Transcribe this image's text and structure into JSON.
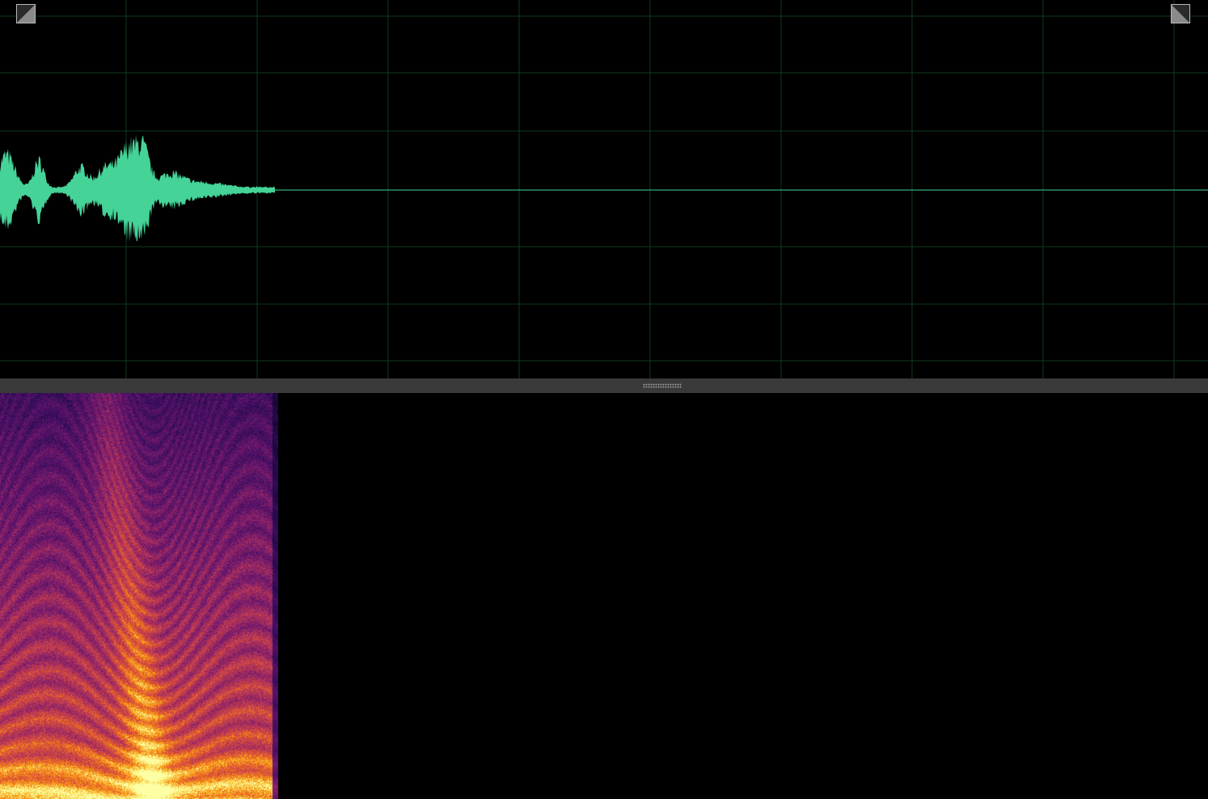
{
  "app": {
    "view": "waveform-and-spectral-display"
  },
  "colors": {
    "background": "#000000",
    "grid": "#0f3a1c",
    "waveform": "#45d398",
    "splitter": "#3a3a3a",
    "handle_border": "#b8b8b8",
    "handle_fill": "#8a8a8a"
  },
  "waveform": {
    "grid_columns": 9,
    "grid_rows": 6,
    "audio_end_fraction": 0.227
  },
  "spectrogram": {
    "colormap": "inferno",
    "audio_end_fraction": 0.23
  },
  "icons": {
    "fade_in": "fade-in-icon",
    "fade_out": "fade-out-icon",
    "splitter_grip": "grip-dots-icon"
  }
}
